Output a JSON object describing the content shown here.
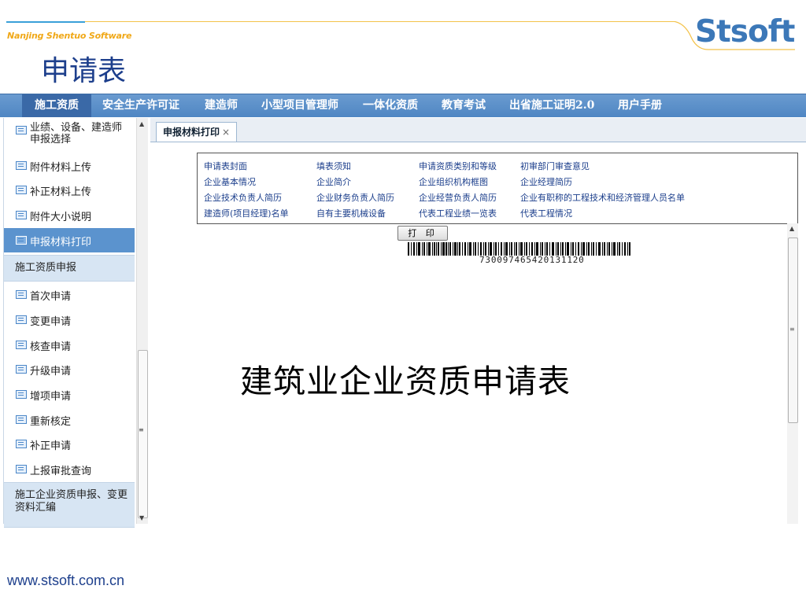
{
  "slide": {
    "company": "Nanjing Shentuo Software",
    "logo": "Stsoft",
    "title": "申请表",
    "footer_url": "www.stsoft.com.cn"
  },
  "menu": [
    {
      "label": "施工资质",
      "active": true
    },
    {
      "label": "安全生产许可证"
    },
    {
      "label": "建造师"
    },
    {
      "label": "小型项目管理师"
    },
    {
      "label": "一体化资质"
    },
    {
      "label": "教育考试"
    },
    {
      "label": "出省施工证明2.0"
    },
    {
      "label": "用户手册"
    }
  ],
  "sidebar": {
    "top_items": [
      {
        "label": "业绩、设备、建造师申报选择"
      },
      {
        "label": "附件材料上传"
      },
      {
        "label": "补正材料上传"
      },
      {
        "label": "附件大小说明"
      },
      {
        "label": "申报材料打印",
        "selected": true
      }
    ],
    "section1": "施工资质申报",
    "section1_items": [
      {
        "label": "首次申请"
      },
      {
        "label": "变更申请"
      },
      {
        "label": "核查申请"
      },
      {
        "label": "升级申请"
      },
      {
        "label": "增项申请"
      },
      {
        "label": "重新核定"
      },
      {
        "label": "补正申请"
      },
      {
        "label": "上报审批查询"
      }
    ],
    "section2": "施工企业资质申报、变更资料汇编"
  },
  "tab": {
    "label": "申报材料打印",
    "close": "×"
  },
  "links": [
    "申请表封面",
    "填表须知",
    "申请资质类别和等级",
    "初审部门审查意见",
    "企业基本情况",
    "企业简介",
    "企业组织机构框图",
    "企业经理简历",
    "企业技术负责人简历",
    "企业财务负责人简历",
    "企业经营负责人简历",
    "企业有职称的工程技术和经济管理人员名单",
    "建造师(项目经理)名单",
    "自有主要机械设备",
    "代表工程业绩一览表",
    "代表工程情况"
  ],
  "print_button": "打 印",
  "barcode_number": "730097465420131120",
  "document_title": "建筑业企业资质申请表",
  "colors": {
    "menu_bar": "#5589c6",
    "menu_active": "#3a69a7",
    "sidebar_selected": "#5b93ce",
    "logo": "#3c78b8",
    "title": "#1d3f8c",
    "company": "#f0a818"
  }
}
